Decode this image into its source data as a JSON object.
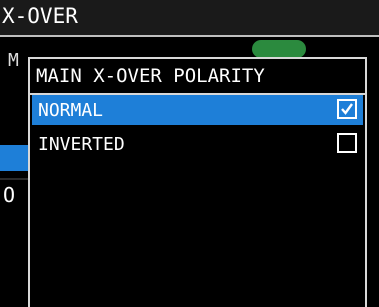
{
  "header": {
    "title": "X-OVER"
  },
  "background": {
    "peek_letter_m": "M",
    "peek_letter_o": "O"
  },
  "dialog": {
    "title": "MAIN X-OVER POLARITY",
    "options": [
      {
        "label": "NORMAL",
        "checked": true
      },
      {
        "label": "INVERTED",
        "checked": false
      }
    ]
  },
  "colors": {
    "selection": "#1e7fd8",
    "toggle_on": "#2b8a3e",
    "border": "#d8d8d8"
  }
}
